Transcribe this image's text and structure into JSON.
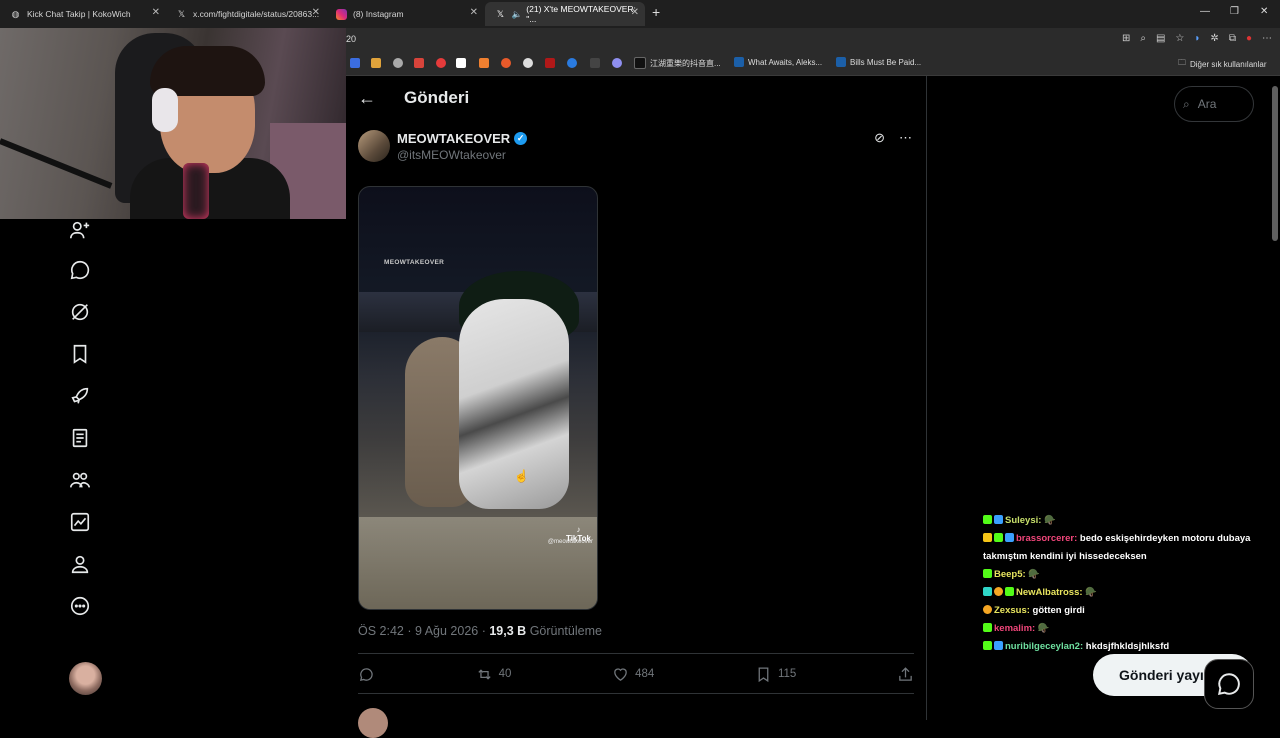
{
  "browser": {
    "tabs": [
      {
        "title": "Kick Chat Takip | KokoWich",
        "icon": "globe-icon"
      },
      {
        "title": "x.com/fightdigitale/status/20863...",
        "icon": "x-logo-icon"
      },
      {
        "title": "(8) Instagram",
        "icon": "instagram-icon"
      },
      {
        "title": "(21) X'te MEOWTAKEOVER: \"...",
        "icon": "x-logo-icon"
      }
    ],
    "address_prefix": "20",
    "bookmarks": [
      {
        "label": "江湖重樂的抖音直...",
        "icon": "tiktok-icon"
      },
      {
        "label": "What Awaits, Aleks...",
        "icon": "steam-icon"
      },
      {
        "label": "Bills Must Be Paid...",
        "icon": "steam-icon"
      }
    ],
    "bookmarks_folder": "Diğer sık kullanılanlar"
  },
  "page": {
    "header_title": "Gönderi",
    "author": {
      "name": "MEOWTAKEOVER",
      "handle": "@itsMEOWtakeover",
      "verified": true
    },
    "media": {
      "watermark": "MEOWTAKEOVER",
      "tiktok_label": "TikTok",
      "tiktok_handle": "@meowtakeover"
    },
    "meta": {
      "time": "ÖS 2:42",
      "date": "9 Ağu 2026",
      "views": "19,3 B",
      "views_label": "Görüntüleme"
    },
    "actions": {
      "reposts": "40",
      "likes": "484",
      "bookmarks": "115"
    }
  },
  "right": {
    "search_placeholder": "Ara",
    "post_button": "Gönderi yayı",
    "chat": [
      {
        "user": "Suleysi:",
        "color": "#c8e06b",
        "text": "🪖"
      },
      {
        "user": "brassorcerer:",
        "color": "#f0467a",
        "text": "bedo eskişehirdeyken motoru dubaya takmıştım kendini iyi hissedeceksen"
      },
      {
        "user": "Beep5:",
        "color": "#e8e55f",
        "text": "🪖"
      },
      {
        "user": "NewAlbatross:",
        "color": "#e8e55f",
        "text": "🪖"
      },
      {
        "user": "Zexsus:",
        "color": "#e8e55f",
        "text": "götten girdi"
      },
      {
        "user": "kemalim:",
        "color": "#f0467a",
        "text": "🪖"
      },
      {
        "user": "nuribilgeceylan2:",
        "color": "#6fe0a0",
        "text": "hkdsjfhkldsjhlksfd"
      }
    ]
  }
}
